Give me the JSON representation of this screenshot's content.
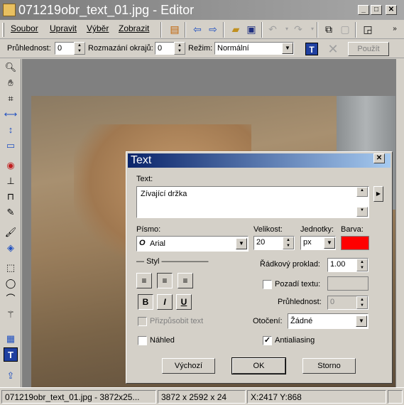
{
  "window": {
    "title": "071219obr_text_01.jpg - Editor",
    "min_label": "_",
    "max_label": "□",
    "close_label": "✕"
  },
  "menu": {
    "items": [
      "Soubor",
      "Upravit",
      "Výběr",
      "Zobrazit"
    ]
  },
  "options": {
    "opacity_label": "Průhlednost:",
    "opacity_value": "0",
    "blur_label": "Rozmazání okrajů:",
    "blur_value": "0",
    "mode_label": "Režim:",
    "mode_value": "Normální",
    "apply_label": "Použít"
  },
  "dialog": {
    "title": "Text",
    "text_label": "Text:",
    "text_value": "Zívající držka",
    "font_label": "Písmo:",
    "font_value": "Arial",
    "size_label": "Velikost:",
    "size_value": "20",
    "units_label": "Jednotky:",
    "units_value": "px",
    "color_label": "Barva:",
    "color_value": "#ff0000",
    "style_label": "Styl",
    "bold_label": "B",
    "italic_label": "I",
    "underline_label": "U",
    "line_spacing_label": "Řádkový proklad:",
    "line_spacing_value": "1.00",
    "background_label": "Pozadí textu:",
    "bg_opacity_label": "Průhlednost:",
    "bg_opacity_value": "0",
    "fit_text_label": "Přizpůsobit text",
    "rotation_label": "Otočení:",
    "rotation_value": "Žádné",
    "preview_label": "Náhled",
    "antialias_label": "Antialiasing",
    "antialias_checked": true,
    "default_label": "Výchozí",
    "ok_label": "OK",
    "cancel_label": "Storno"
  },
  "status": {
    "file": "071219obr_text_01.jpg - 3872x25...",
    "dimensions": "3872 x 2592 x 24",
    "coords": "X:2417  Y:868"
  }
}
